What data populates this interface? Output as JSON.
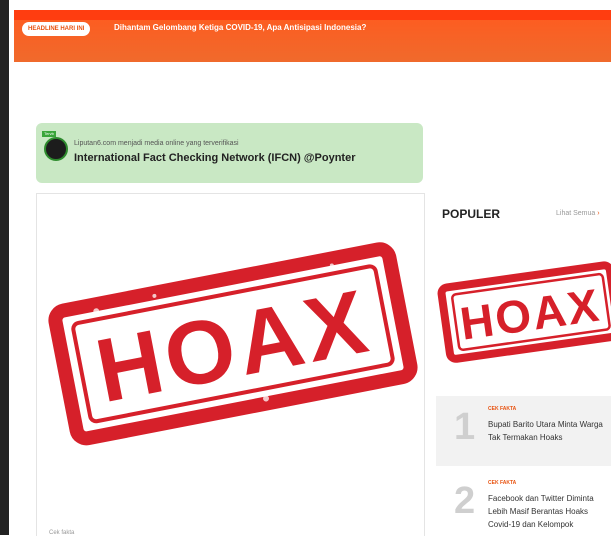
{
  "topbar": {
    "badge": "HEADLINE HARI INI",
    "headline": "Dihantam Gelombang Ketiga COVID-19, Apa Antisipasi Indonesia?"
  },
  "verification": {
    "logo_text": "Tervb",
    "small_text": "Liputan6.com menjadi media online yang terverifikasi",
    "big_text": "International Fact Checking Network (IFCN) @Poynter"
  },
  "article": {
    "stamp_text": "HOAX",
    "footnote": "Cek fakta",
    "stamp_color": "#d6202a"
  },
  "populer": {
    "title": "POPULER",
    "see_all": "Lihat Semua",
    "stamp_text": "HOAX",
    "items": [
      {
        "number": "1",
        "category": "CEK FAKTA",
        "title": "Bupati Barito Utara Minta Warga Tak Termakan Hoaks"
      },
      {
        "number": "2",
        "category": "CEK FAKTA",
        "title": "Facebook dan Twitter Diminta Lebih Masif Berantas Hoaks Covid-19 dan Kelompok"
      }
    ]
  },
  "colors": {
    "accent": "#ff5a1f",
    "verify_bg": "#c9e8c4"
  }
}
